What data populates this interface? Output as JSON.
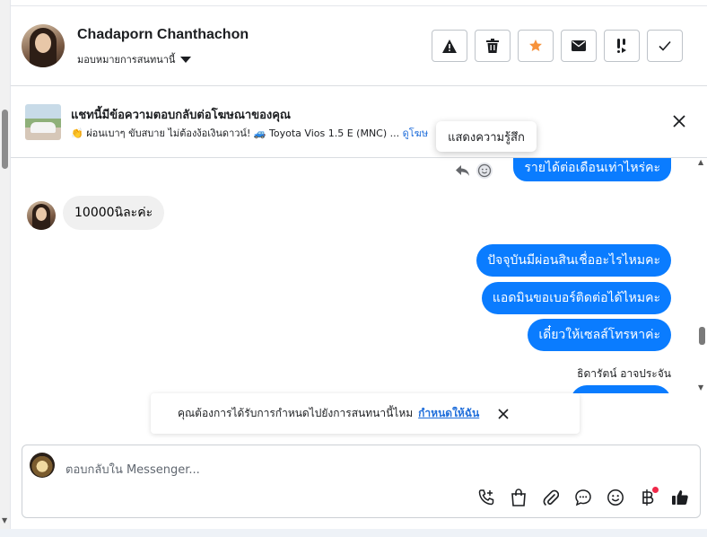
{
  "contact": {
    "name": "Chadaporn Chanthachon",
    "assign_label": "มอบหมายการสนทนานี้"
  },
  "actions": [
    {
      "name": "report-button",
      "icon": "warning-icon"
    },
    {
      "name": "delete-button",
      "icon": "trash-icon"
    },
    {
      "name": "star-button",
      "icon": "star-icon",
      "color": "#f7923b"
    },
    {
      "name": "mark-unread-button",
      "icon": "envelope-icon"
    },
    {
      "name": "follow-up-button",
      "icon": "exclamation-icon"
    },
    {
      "name": "done-button",
      "icon": "check-icon"
    }
  ],
  "ad_banner": {
    "title": "แชทนี้มีข้อความตอบกลับต่อโฆษณาของคุณ",
    "subtitle": "👏 ผ่อนเบาๆ ขับสบาย ไม่ต้องง้อเงินดาวน์! 🚙 Toyota Vios 1.5 E (MNC) ...",
    "link": "ดูโฆษ"
  },
  "tooltip": "แสดงความรู้สึก",
  "messages": {
    "m1": "รายได้ต่อเดือนเท่าไหร่คะ",
    "m2": "10000นิละค่ะ",
    "m3": "ปัจจุบันมีผ่อนสินเชื่ออะไรไหมคะ",
    "m4": "แอดมินขอเบอร์ติดต่อได้ไหมคะ",
    "m5": "เดี๋ยวให้เซลส์โทรหาค่ะ",
    "sender": "ธิดารัตน์ อาจประจัน"
  },
  "prompt": {
    "text": "คุณต้องการได้รับการกำหนดไปยังการสนทนานี้ไหม",
    "link": "กำหนดให้ฉัน"
  },
  "composer": {
    "placeholder": "ตอบกลับใน Messenger..."
  },
  "colors": {
    "outgoing_bubble": "#0a7cff",
    "incoming_bubble": "#f0f0f0",
    "link": "#216fdb",
    "notification_dot": "#f02849"
  }
}
